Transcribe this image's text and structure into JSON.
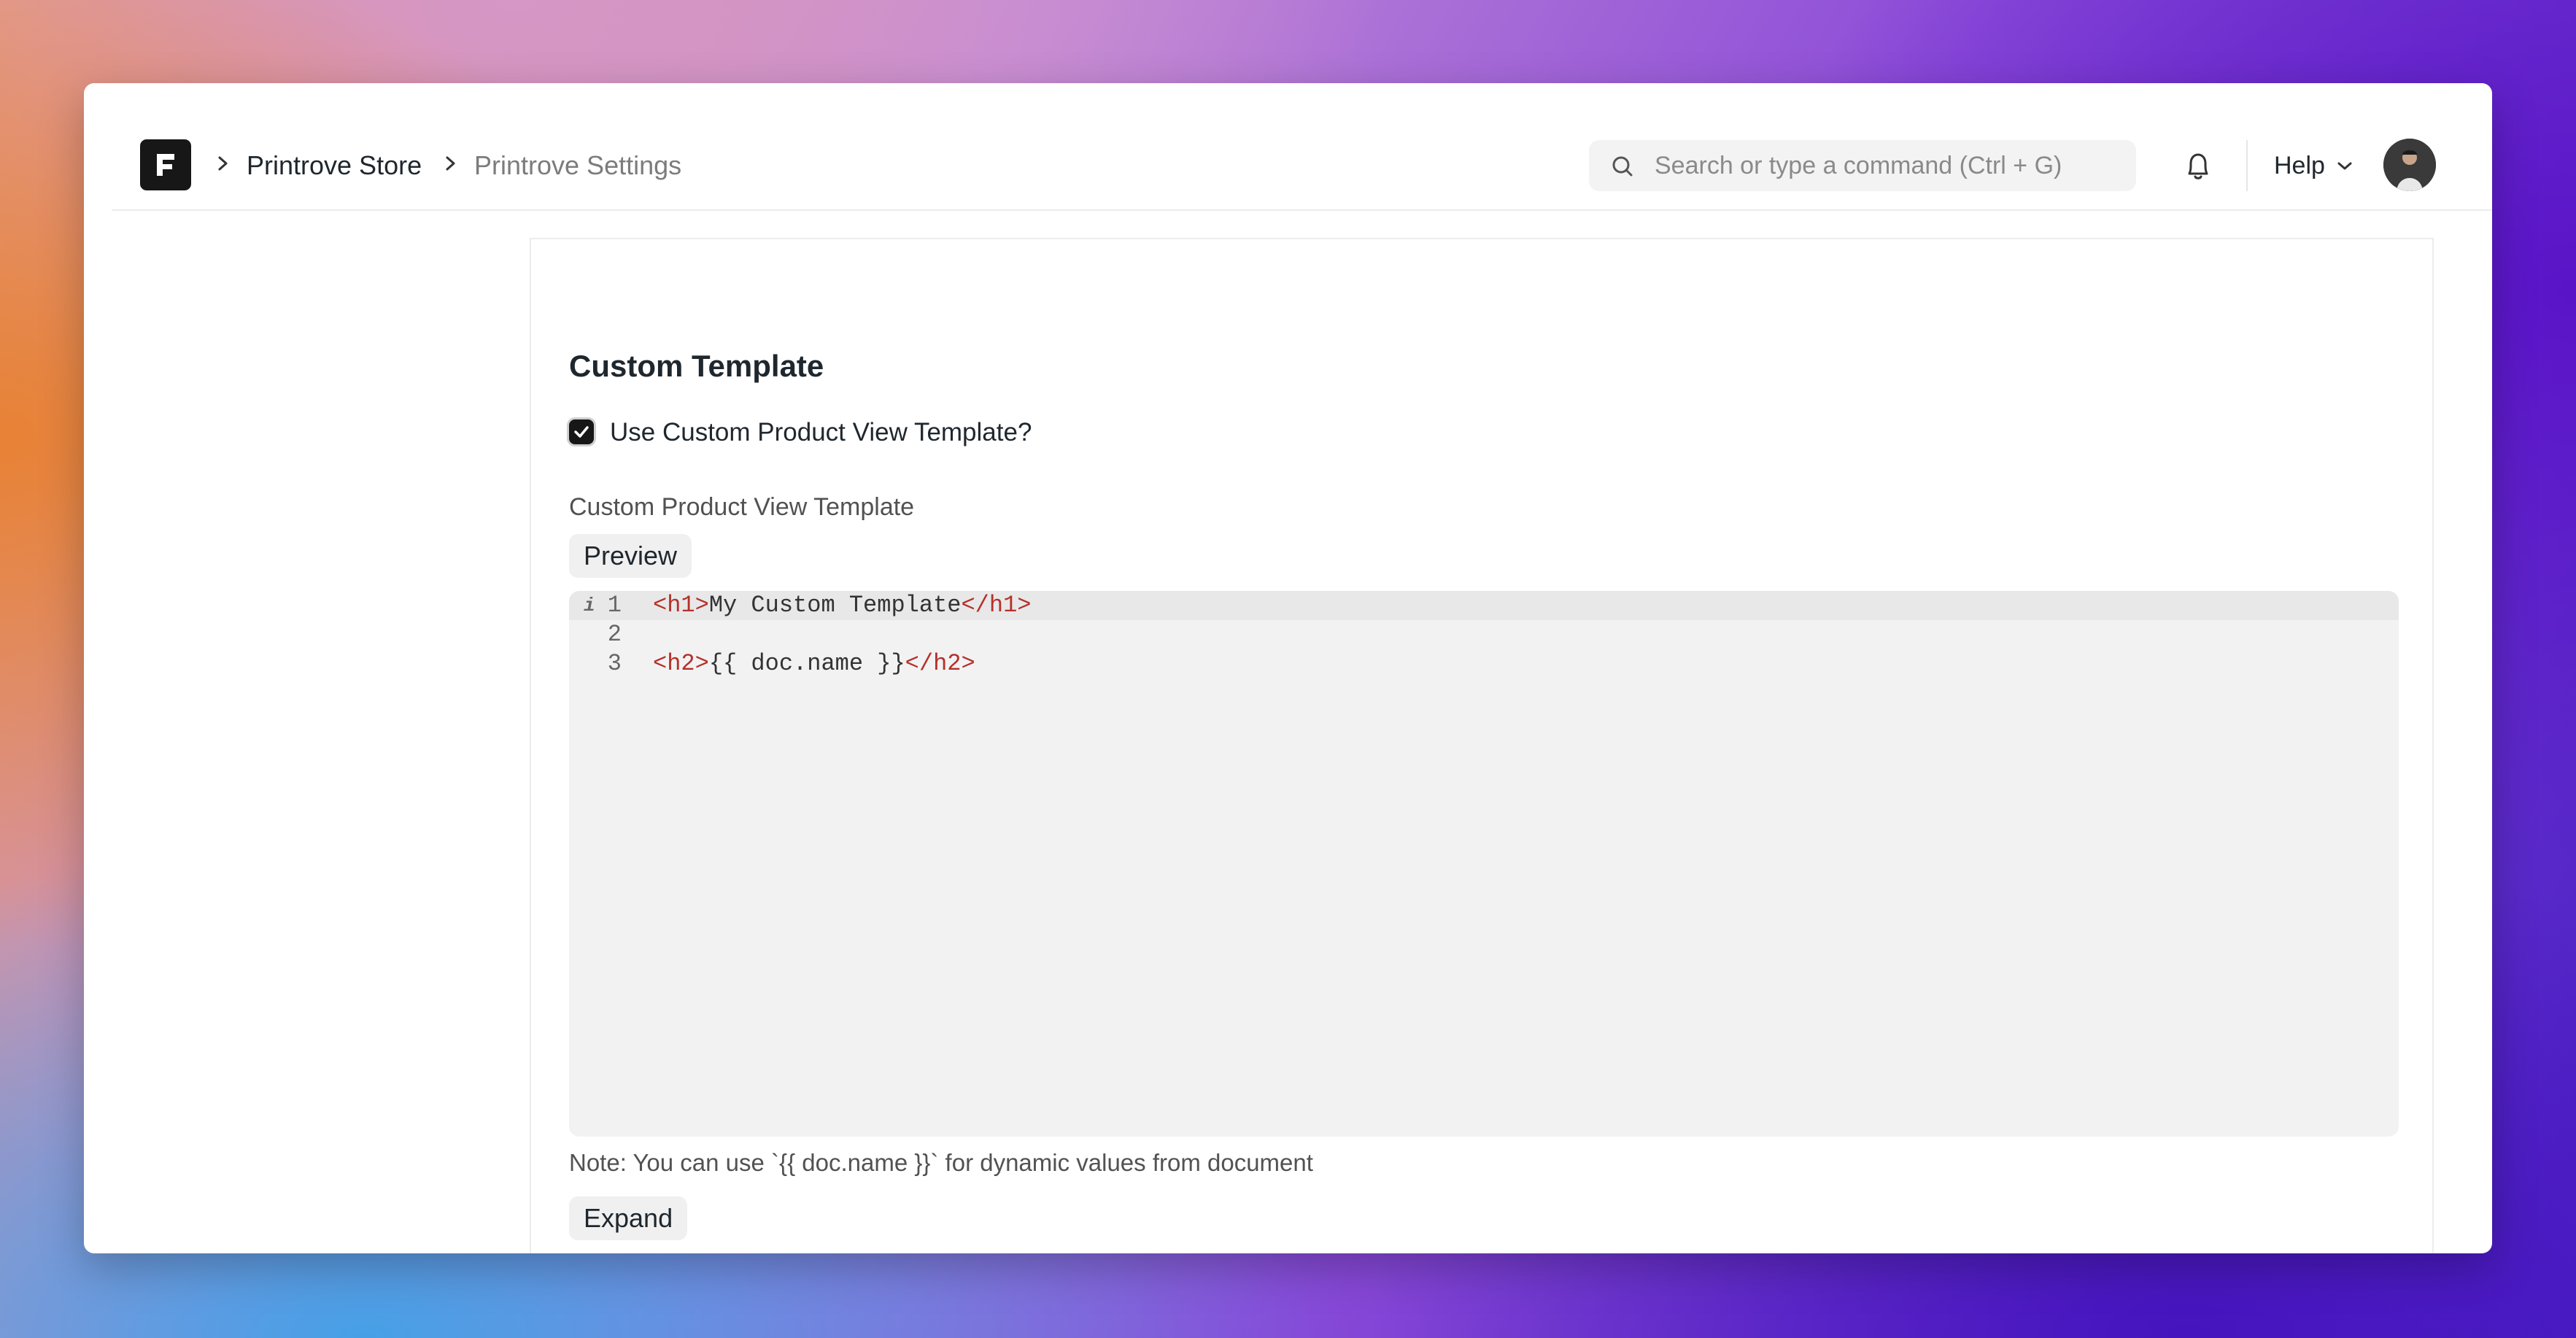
{
  "navbar": {
    "breadcrumbs": [
      {
        "label": "Printrove Store"
      },
      {
        "label": "Printrove Settings"
      }
    ],
    "search": {
      "placeholder": "Search or type a command (Ctrl + G)"
    },
    "help_label": "Help"
  },
  "section": {
    "title": "Custom Template",
    "checkbox": {
      "label": "Use Custom Product View Template?",
      "checked": true
    },
    "field_label": "Custom Product View Template",
    "preview_button": "Preview",
    "editor": {
      "lines": [
        {
          "number": "1",
          "open_tag": "<h1>",
          "text": "My Custom Template",
          "close_tag": "</h1>"
        },
        {
          "number": "2",
          "open_tag": "",
          "text": "",
          "close_tag": ""
        },
        {
          "number": "3",
          "open_tag": "<h2>",
          "text": "{{ doc.name }}",
          "close_tag": "</h2>"
        }
      ],
      "info_marker": "i"
    },
    "note": "Note: You can use `{{ doc.name }}` for dynamic values from document",
    "expand_button": "Expand"
  },
  "colors": {
    "accent": "#171717",
    "tag": "#b5302a",
    "editor_bg": "#f2f2f2"
  }
}
